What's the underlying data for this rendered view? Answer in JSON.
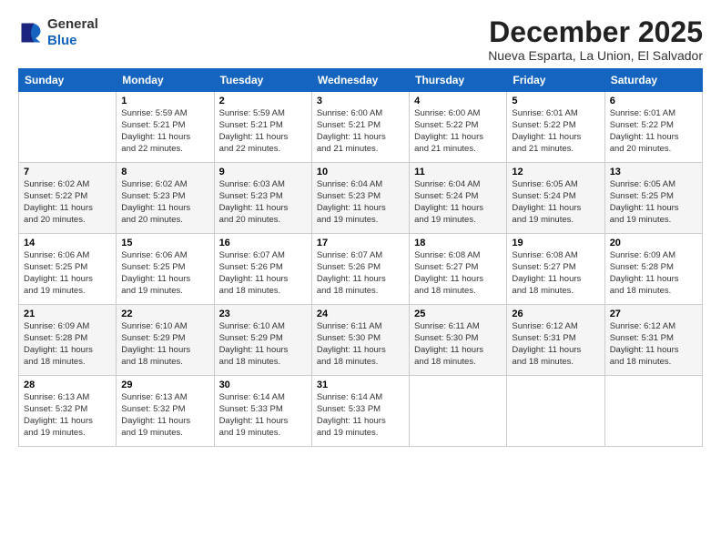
{
  "logo": {
    "general": "General",
    "blue": "Blue"
  },
  "title": "December 2025",
  "subtitle": "Nueva Esparta, La Union, El Salvador",
  "days_header": [
    "Sunday",
    "Monday",
    "Tuesday",
    "Wednesday",
    "Thursday",
    "Friday",
    "Saturday"
  ],
  "weeks": [
    [
      {
        "day": "",
        "detail": ""
      },
      {
        "day": "1",
        "detail": "Sunrise: 5:59 AM\nSunset: 5:21 PM\nDaylight: 11 hours\nand 22 minutes."
      },
      {
        "day": "2",
        "detail": "Sunrise: 5:59 AM\nSunset: 5:21 PM\nDaylight: 11 hours\nand 22 minutes."
      },
      {
        "day": "3",
        "detail": "Sunrise: 6:00 AM\nSunset: 5:21 PM\nDaylight: 11 hours\nand 21 minutes."
      },
      {
        "day": "4",
        "detail": "Sunrise: 6:00 AM\nSunset: 5:22 PM\nDaylight: 11 hours\nand 21 minutes."
      },
      {
        "day": "5",
        "detail": "Sunrise: 6:01 AM\nSunset: 5:22 PM\nDaylight: 11 hours\nand 21 minutes."
      },
      {
        "day": "6",
        "detail": "Sunrise: 6:01 AM\nSunset: 5:22 PM\nDaylight: 11 hours\nand 20 minutes."
      }
    ],
    [
      {
        "day": "7",
        "detail": "Sunrise: 6:02 AM\nSunset: 5:22 PM\nDaylight: 11 hours\nand 20 minutes."
      },
      {
        "day": "8",
        "detail": "Sunrise: 6:02 AM\nSunset: 5:23 PM\nDaylight: 11 hours\nand 20 minutes."
      },
      {
        "day": "9",
        "detail": "Sunrise: 6:03 AM\nSunset: 5:23 PM\nDaylight: 11 hours\nand 20 minutes."
      },
      {
        "day": "10",
        "detail": "Sunrise: 6:04 AM\nSunset: 5:23 PM\nDaylight: 11 hours\nand 19 minutes."
      },
      {
        "day": "11",
        "detail": "Sunrise: 6:04 AM\nSunset: 5:24 PM\nDaylight: 11 hours\nand 19 minutes."
      },
      {
        "day": "12",
        "detail": "Sunrise: 6:05 AM\nSunset: 5:24 PM\nDaylight: 11 hours\nand 19 minutes."
      },
      {
        "day": "13",
        "detail": "Sunrise: 6:05 AM\nSunset: 5:25 PM\nDaylight: 11 hours\nand 19 minutes."
      }
    ],
    [
      {
        "day": "14",
        "detail": "Sunrise: 6:06 AM\nSunset: 5:25 PM\nDaylight: 11 hours\nand 19 minutes."
      },
      {
        "day": "15",
        "detail": "Sunrise: 6:06 AM\nSunset: 5:25 PM\nDaylight: 11 hours\nand 19 minutes."
      },
      {
        "day": "16",
        "detail": "Sunrise: 6:07 AM\nSunset: 5:26 PM\nDaylight: 11 hours\nand 18 minutes."
      },
      {
        "day": "17",
        "detail": "Sunrise: 6:07 AM\nSunset: 5:26 PM\nDaylight: 11 hours\nand 18 minutes."
      },
      {
        "day": "18",
        "detail": "Sunrise: 6:08 AM\nSunset: 5:27 PM\nDaylight: 11 hours\nand 18 minutes."
      },
      {
        "day": "19",
        "detail": "Sunrise: 6:08 AM\nSunset: 5:27 PM\nDaylight: 11 hours\nand 18 minutes."
      },
      {
        "day": "20",
        "detail": "Sunrise: 6:09 AM\nSunset: 5:28 PM\nDaylight: 11 hours\nand 18 minutes."
      }
    ],
    [
      {
        "day": "21",
        "detail": "Sunrise: 6:09 AM\nSunset: 5:28 PM\nDaylight: 11 hours\nand 18 minutes."
      },
      {
        "day": "22",
        "detail": "Sunrise: 6:10 AM\nSunset: 5:29 PM\nDaylight: 11 hours\nand 18 minutes."
      },
      {
        "day": "23",
        "detail": "Sunrise: 6:10 AM\nSunset: 5:29 PM\nDaylight: 11 hours\nand 18 minutes."
      },
      {
        "day": "24",
        "detail": "Sunrise: 6:11 AM\nSunset: 5:30 PM\nDaylight: 11 hours\nand 18 minutes."
      },
      {
        "day": "25",
        "detail": "Sunrise: 6:11 AM\nSunset: 5:30 PM\nDaylight: 11 hours\nand 18 minutes."
      },
      {
        "day": "26",
        "detail": "Sunrise: 6:12 AM\nSunset: 5:31 PM\nDaylight: 11 hours\nand 18 minutes."
      },
      {
        "day": "27",
        "detail": "Sunrise: 6:12 AM\nSunset: 5:31 PM\nDaylight: 11 hours\nand 18 minutes."
      }
    ],
    [
      {
        "day": "28",
        "detail": "Sunrise: 6:13 AM\nSunset: 5:32 PM\nDaylight: 11 hours\nand 19 minutes."
      },
      {
        "day": "29",
        "detail": "Sunrise: 6:13 AM\nSunset: 5:32 PM\nDaylight: 11 hours\nand 19 minutes."
      },
      {
        "day": "30",
        "detail": "Sunrise: 6:14 AM\nSunset: 5:33 PM\nDaylight: 11 hours\nand 19 minutes."
      },
      {
        "day": "31",
        "detail": "Sunrise: 6:14 AM\nSunset: 5:33 PM\nDaylight: 11 hours\nand 19 minutes."
      },
      {
        "day": "",
        "detail": ""
      },
      {
        "day": "",
        "detail": ""
      },
      {
        "day": "",
        "detail": ""
      }
    ]
  ]
}
